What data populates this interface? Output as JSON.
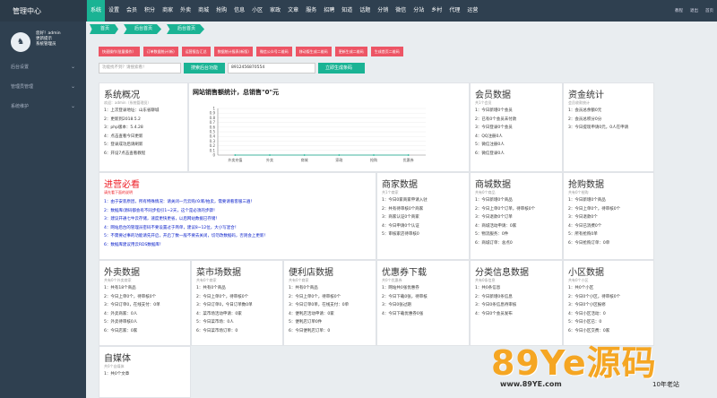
{
  "header": {
    "brand": "管理中心",
    "nav": [
      "系统",
      "设置",
      "会员",
      "积分",
      "商家",
      "外卖",
      "商城",
      "抢购",
      "信息",
      "小区",
      "家政",
      "文章",
      "服务",
      "招聘",
      "知道",
      "话题",
      "分销",
      "微信",
      "分站",
      "乡村",
      "代理",
      "运营"
    ],
    "right": [
      "教程",
      "退出",
      "首页"
    ]
  },
  "sidebar": {
    "user_line1": "您好！admin",
    "user_line2": "更新提示",
    "user_line3": "系统管理员",
    "items": [
      "后台设置",
      "管理员管理",
      "系统维护"
    ]
  },
  "breadcrumb": [
    "首页",
    "后台首页",
    "后台首页"
  ],
  "actions": [
    "快速操作(批量操作）",
    "订单数据统计(新)",
    "运营报告汇总",
    "数据统计报表(新版)",
    "微信公众号二维码",
    "移动版生成二维码",
    "更新生成二维码",
    "生成首页二维码"
  ],
  "toolbar": {
    "input_placeholder": "功能找不到？请搜索看！",
    "search_btn": "搜索后台功能",
    "code_value": "8912456870554",
    "gen_btn": "立即生成条码"
  },
  "system": {
    "title": "系统概况",
    "sub": "欢迎：admin（系统管理员）",
    "lines": [
      "1：上次登录地址：山东省聊城",
      "2：更新到2018.5.2",
      "3：php版本：5.4.28",
      "4：点击查看今日更新",
      "5：登录成功后请刷新",
      "6：开设7点击查看教程"
    ]
  },
  "chart_data": {
    "type": "line",
    "title": "网站销售额统计，总销售\"0\"元",
    "categories": [
      "外卖充值",
      "外卖",
      "商城",
      "家政",
      "抢购",
      "优惠券"
    ],
    "values": [
      0,
      0,
      0,
      0,
      0,
      0
    ],
    "ylim": [
      0,
      1
    ],
    "yticks": [
      "0",
      "0.1",
      "0.2",
      "0.3",
      "0.4",
      "0.5",
      "0.6",
      "0.7",
      "0.8",
      "0.9",
      "1"
    ]
  },
  "member": {
    "title": "会员数据",
    "sub": "共1个会员",
    "lines": [
      "1：今日新增0个会员",
      "2：已有0个会员未付款",
      "3：今日登录0个会员",
      "4：QQ注册0人",
      "5：微信注册0人",
      "6：微信登录0人"
    ]
  },
  "funds": {
    "title": "资金统计",
    "sub": "会员收款统计",
    "lines": [
      "1：会员总余额0元",
      "2：会员总积分0分",
      "3：今日提现申请0元，0人在申请"
    ]
  },
  "notice": {
    "title": "进营必看",
    "sub": "请先看下面的说明",
    "lines": [
      "1：由于安装原因，所有特殊情况：请关闭一元云购/众筹/拍卖，需要请看客服三遍！",
      "2：数据库/源码都会有不同步指引1~2天，这个是必须的步骤！",
      "3：建议开通七牛云存储，速度更快更省，以后网站数据已存储！",
      "4：网站后台的管理员密码不要设置过于简单，建议8~12位，大小写混合！",
      "5：不需要过事的功能请先开启，开启了数一般不要去关闭，切勿改数据码，否则会上更新！",
      "6：数据库建议用云RDS数据库！"
    ]
  },
  "shop": {
    "title": "商家数据",
    "sub": "共1个商家",
    "lines": [
      "1：今日0家商家申请入驻",
      "2：共有待审核0个商家",
      "3：商家认证0个商家",
      "4：今日申请0个认证",
      "5：审核家店待审核0"
    ]
  },
  "mall": {
    "title": "商城数据",
    "sub": "共有0个商品",
    "lines": [
      "1：今日新增0个商品",
      "2：今日上单0个订单，待审核0个",
      "3：今日退款0个订单",
      "4：商城活动申请：0家",
      "5：物流服务：0件",
      "6：商城订单：总点0"
    ]
  },
  "tuan": {
    "title": "抢购数据",
    "sub": "共有0个抢购",
    "lines": [
      "1：今日新增0个商品",
      "2：今日上单0个，待审核0个",
      "3：今日退款0个",
      "4：今日已消费0个",
      "5：所有抢购0单",
      "6：今日抢购订单：0单"
    ]
  },
  "waimai": {
    "title": "外卖数据",
    "sub": "共有0个外卖商家",
    "lines": [
      "1：共有18个商品",
      "2：今日上单0个，待审核0个",
      "3：今日订单0，在线支付：0单",
      "4：外卖商家：0人",
      "5：外卖待审核0人",
      "6：今日店家：0家"
    ]
  },
  "market": {
    "title": "菜市场数据",
    "sub": "共有0个商家",
    "lines": [
      "1：共有0个商品",
      "2：今日上单0个，待审核0个",
      "3：今日订单0，今日订单数0单",
      "4：菜市场活动申请：0家",
      "5：今日菜市场：0人",
      "6：今日菜市场订单：0"
    ]
  },
  "store": {
    "title": "便利店数据",
    "sub": "共有0个商家",
    "lines": [
      "1：共有0个商品",
      "2：今日上单0个，待审核0个",
      "3：今日订单0单，在线支付：0单",
      "4：便利店活动申请：0家",
      "5：便利店订单0件",
      "6：今日便利店订单：0"
    ]
  },
  "coupon": {
    "title": "优惠券下载",
    "sub": "共0个优惠券",
    "lines": [
      "1：网站共0张优惠券",
      "2：今日下载0张，待审核",
      "3：今日0张过期",
      "4：今日下载优惠券0张"
    ]
  },
  "classify": {
    "title": "分类信息数据",
    "sub": "共有0条信息",
    "lines": [
      "1：共0条信息",
      "2：今日新增0条信息",
      "3：今日0条信息待审核",
      "4：今日0个会员发布"
    ]
  },
  "community": {
    "title": "小区数据",
    "sub": "共有0个小区",
    "lines": [
      "1：共0个小区",
      "2：今日0个小区，待审核0个",
      "3：今日0个小区报修",
      "4：今日小区活动：0",
      "5：今日小区已：0",
      "6：今日小区交费：0家"
    ]
  },
  "media": {
    "title": "自媒体",
    "sub": "共0个自媒体",
    "lines": [
      "1：共0个文章"
    ]
  },
  "watermark": {
    "logo": "89Ye源码",
    "url": "www.89YE.com",
    "note": "10年老站"
  }
}
